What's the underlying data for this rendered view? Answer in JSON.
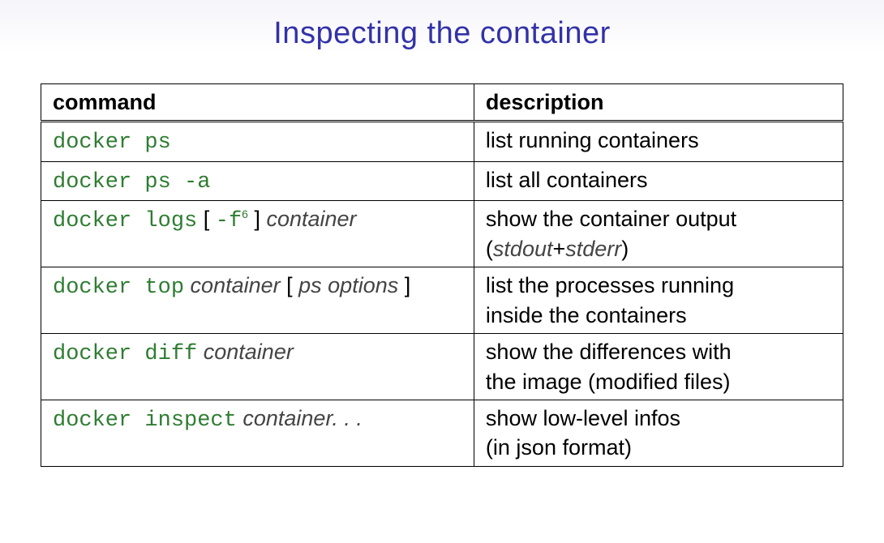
{
  "title": "Inspecting the container",
  "headers": {
    "command": "command",
    "description": "description"
  },
  "rows": [
    {
      "cmd": {
        "code": "docker ps"
      },
      "desc": {
        "line1": "list running containers"
      }
    },
    {
      "cmd": {
        "code": "docker ps -a"
      },
      "desc": {
        "line1": "list all containers"
      }
    },
    {
      "cmd": {
        "code_prefix": "docker logs",
        "bracket_open": " [ ",
        "flag": "-f",
        "sup": "6",
        "bracket_close": " ] ",
        "arg": "container"
      },
      "desc": {
        "line1": "show the container output",
        "line2_open": "(",
        "line2_arg1": "stdout",
        "line2_plus": "+",
        "line2_arg2": "stderr",
        "line2_close": ")"
      }
    },
    {
      "cmd": {
        "code_prefix": "docker top",
        "space": " ",
        "arg1": "container",
        "bracket_open": " [ ",
        "arg2": "ps options",
        "bracket_close": "  ]"
      },
      "desc": {
        "line1": "list the processes running",
        "line2": "inside the containers"
      }
    },
    {
      "cmd": {
        "code_prefix": "docker diff",
        "space": " ",
        "arg": "container"
      },
      "desc": {
        "line1": "show the differences with",
        "line2": "the image (modified files)"
      }
    },
    {
      "cmd": {
        "code_prefix": "docker inspect",
        "space": " ",
        "arg": "container. . ."
      },
      "desc": {
        "line1": "show low-level infos",
        "line2": "(in json format)"
      }
    }
  ]
}
